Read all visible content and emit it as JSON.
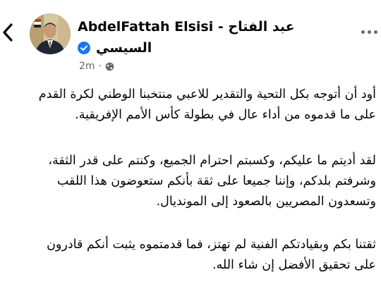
{
  "post": {
    "author": {
      "name_line1": "AbdelFattah Elsisi - عبد الفتاح",
      "name_line2": "السيسي",
      "verified": true
    },
    "time": "2m",
    "visibility_icon": "globe-icon",
    "paragraphs": [
      {
        "lines": [
          "أود أن أتوجه بكل التحية والتقدير للاعبي منتخبنا الوطني لكرة القدم",
          "على ما قدموه من أداء عال في بطولة كأس الأمم الإفريقية."
        ]
      },
      {
        "lines": [
          "لقد أديتم ما عليكم، وكسبتم احترام الجميع، وكنتم على قدر الثقة،",
          "وشرفتم بلدكم، وإننا جميعا على ثقة بأنكم ستعوضون هذا اللقب",
          "وتسعدون المصريين بالصعود إلى المونديال."
        ]
      },
      {
        "lines": [
          "ثقتنا بكم وبقيادتكم الفنية لم تهتز، فما قدمتموه يثبت أنكم قادرون",
          "على تحقيق الأفضل إن شاء الله."
        ]
      }
    ]
  },
  "icons": {
    "back": "chevron-left-icon",
    "more": "more-options-icon",
    "verified": "verified-badge-icon"
  },
  "colors": {
    "verified_blue": "#1877f2",
    "meta_gray": "#65676b",
    "text": "#050505"
  }
}
